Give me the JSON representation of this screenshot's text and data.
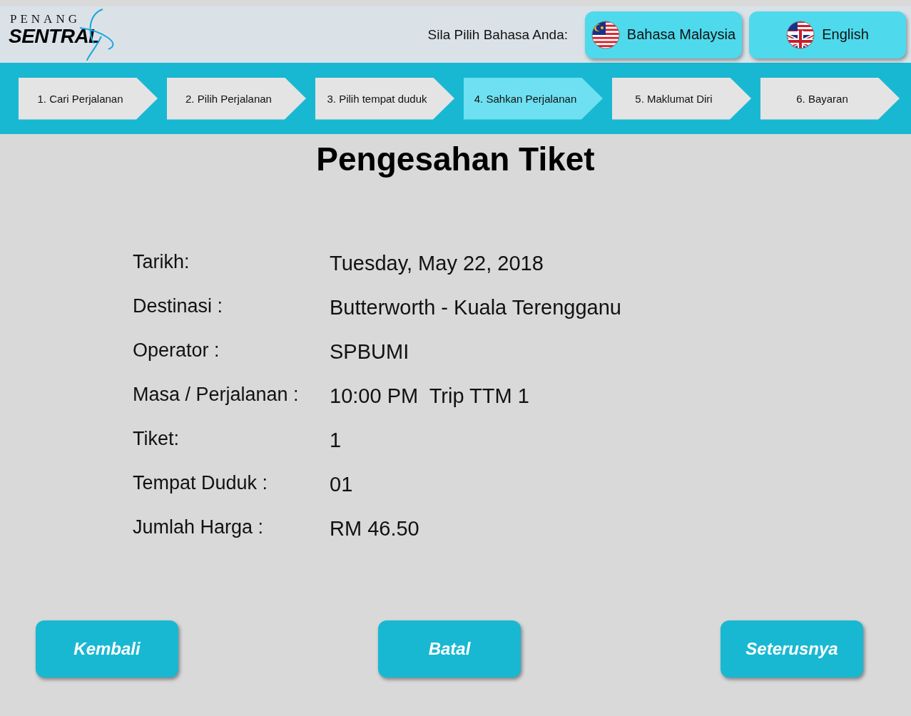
{
  "logo": {
    "top": "PENANG",
    "bottom": "SENTRAL"
  },
  "language": {
    "prompt": "Sila Pilih Bahasa Anda:",
    "options": [
      {
        "label": "Bahasa Malaysia",
        "kind": "malaysia"
      },
      {
        "label": "English",
        "kind": "english"
      }
    ]
  },
  "steps": [
    {
      "label": "1. Cari Perjalanan",
      "selected": false
    },
    {
      "label": "2. Pilih Perjalanan",
      "selected": false
    },
    {
      "label": "3. Pilih tempat duduk",
      "selected": false
    },
    {
      "label": "4. Sahkan Perjalanan",
      "selected": true
    },
    {
      "label": "5. Maklumat Diri",
      "selected": false
    },
    {
      "label": "6. Bayaran",
      "selected": false
    }
  ],
  "title": "Pengesahan Tiket",
  "details": [
    {
      "label": "Tarikh:",
      "value": "Tuesday, May 22, 2018"
    },
    {
      "label": "Destinasi :",
      "value": "Butterworth - Kuala Terengganu"
    },
    {
      "label": "Operator :",
      "value": "SPBUMI"
    },
    {
      "label": "Masa / Perjalanan :",
      "value": "10:00 PM  Trip TTM 1"
    },
    {
      "label": "Tiket:",
      "value": "1"
    },
    {
      "label": "Tempat Duduk :",
      "value": "01"
    },
    {
      "label": "Jumlah Harga :",
      "value": "RM 46.50"
    }
  ],
  "buttons": [
    "Kembali",
    "Batal",
    "Seterusnya"
  ]
}
